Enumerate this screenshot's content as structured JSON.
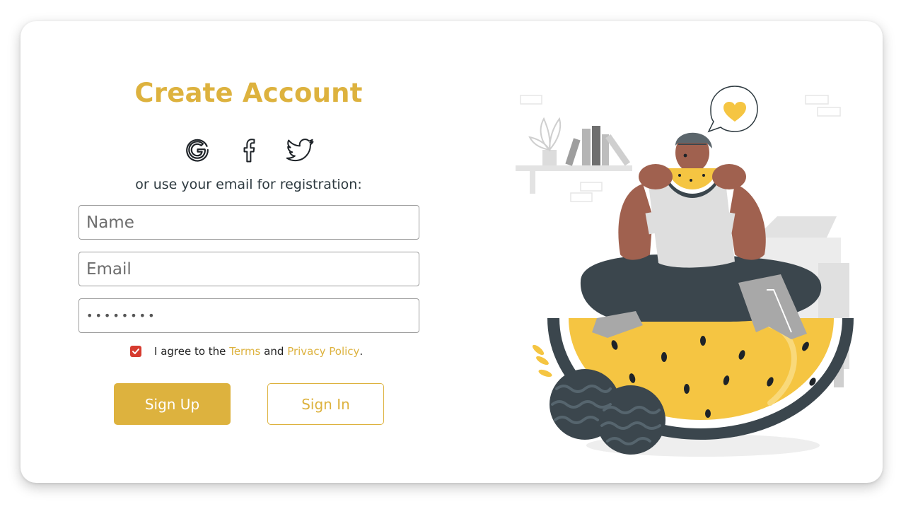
{
  "form": {
    "title": "Create Account",
    "social_icons": [
      "google-icon",
      "facebook-icon",
      "twitter-icon"
    ],
    "subtitle": "or use your email for registration:",
    "name_placeholder": "Name",
    "email_placeholder": "Email",
    "password_value": "••••••••",
    "agree_prefix": "I agree to the",
    "terms_link": "Terms",
    "agree_and": "and",
    "privacy_link": "Privacy Policy",
    "agree_suffix": ".",
    "agreed": true,
    "signup_label": "Sign Up",
    "signin_label": "Sign In"
  },
  "colors": {
    "accent": "#DDB23E",
    "checkbox": "#D63B2F",
    "text": "#2E3A40"
  }
}
